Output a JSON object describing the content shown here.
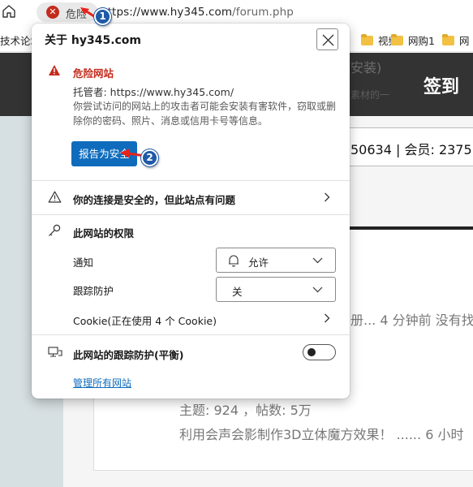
{
  "browser": {
    "site_status": "危险",
    "url_host": "https://www.hy345.com",
    "url_path": "/forum.php",
    "bookmarks": {
      "left_partial": "技术论坛",
      "items": [
        {
          "label": "视频"
        },
        {
          "label": "网购1"
        },
        {
          "label": "网"
        }
      ]
    }
  },
  "page": {
    "sign_in": "签到",
    "ghost_text": "安装)",
    "ghost_sub": "素材的一",
    "stats": "50634 | 会员: 2375",
    "post_preview": "册... 4 分钟前 没有找",
    "forum_stats": "主题: 924 ，帖数: 5万",
    "forum_post": "利用会声会影制作3D立体魔方效果！ ...... 6 小时"
  },
  "popup": {
    "title": "关于 hy345.com",
    "danger": {
      "title": "危险网站",
      "owner": "托管者: https://www.hy345.com/",
      "description": "你尝试访问的网站上的攻击者可能会安装有害软件，窃取或删除你的密码、照片、消息或信用卡号等信息。",
      "report_button": "报告为安全"
    },
    "connection": "你的连接是安全的，但此站点有问题",
    "permissions": {
      "title": "此网站的权限",
      "notification_label": "通知",
      "notification_value": "允许",
      "tracking_label": "跟踪防护",
      "tracking_value": "关",
      "cookies": "Cookie(正在使用 4 个 Cookie)"
    },
    "tracking_prevention": {
      "label": "此网站的跟踪防护(平衡)",
      "enabled": false
    },
    "manage_link": "管理所有网站"
  },
  "annotations": {
    "step1": "1",
    "step2": "2"
  },
  "colors": {
    "danger": "#c42b1c",
    "accent": "#0f6cbd",
    "badge": "#1f5aa6",
    "arrow": "#e8231b"
  }
}
